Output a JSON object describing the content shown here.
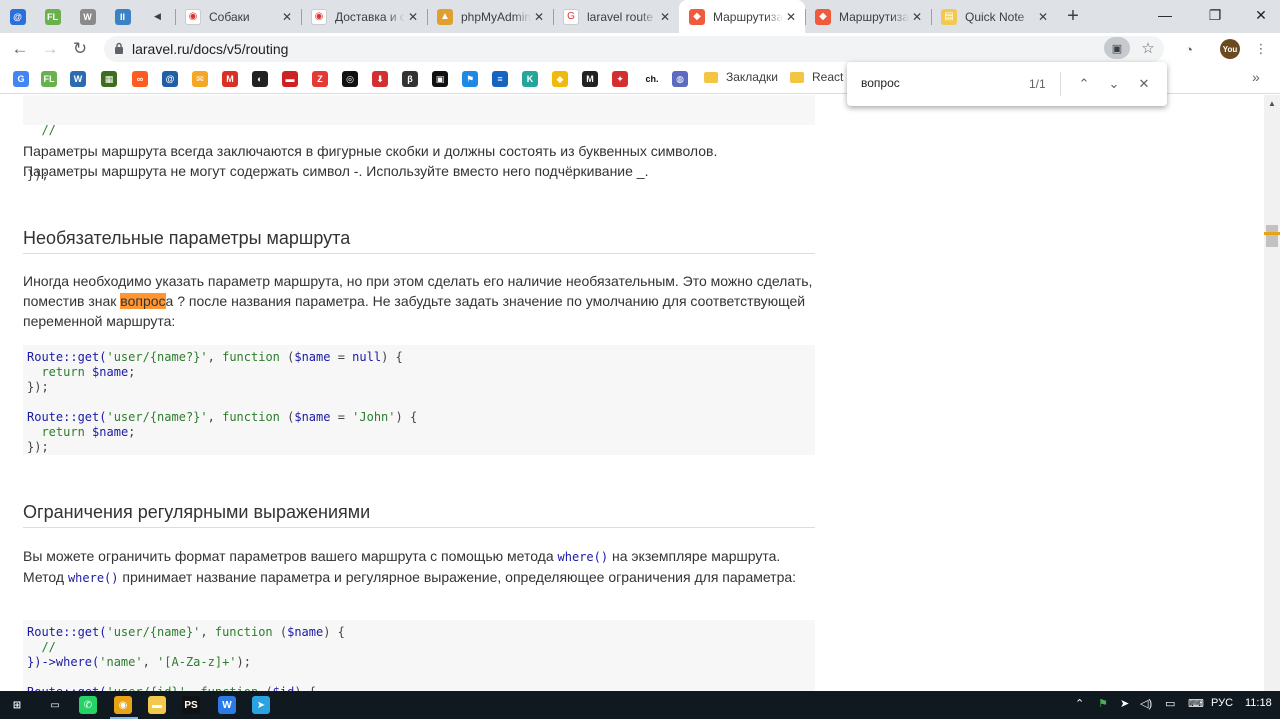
{
  "tabs": {
    "pinned": [
      {
        "name": "tab-pinned-1",
        "icon": "at-sign-icon",
        "glyph": "@",
        "color": "#2a6fdb"
      },
      {
        "name": "tab-pinned-2",
        "icon": "fl-icon",
        "glyph": "FL",
        "color": "#6ab04c"
      },
      {
        "name": "tab-pinned-3",
        "icon": "w-icon",
        "glyph": "W",
        "color": "#8a8a8a"
      },
      {
        "name": "tab-pinned-4",
        "icon": "pause-icon",
        "glyph": "II",
        "color": "#3b82c4"
      },
      {
        "name": "tab-pinned-5",
        "icon": "speaker-icon",
        "glyph": "◀",
        "color": "#dee1e6"
      }
    ],
    "items": [
      {
        "title": "Собаки",
        "icon": "eye-icon",
        "glyph": "◉",
        "color": "#ffffff",
        "active": false
      },
      {
        "title": "Доставка и о",
        "icon": "eye-icon",
        "glyph": "◉",
        "color": "#ffffff",
        "active": false
      },
      {
        "title": "phpMyAdmin",
        "icon": "sailboat-icon",
        "glyph": "▲",
        "color": "#e0a030",
        "active": false
      },
      {
        "title": "laravel route",
        "icon": "google-icon",
        "glyph": "G",
        "color": "#ffffff",
        "active": false
      },
      {
        "title": "Маршрутиза",
        "icon": "laravel-icon",
        "glyph": "◆",
        "color": "#ef5b3c",
        "active": true
      },
      {
        "title": "Маршрутиза",
        "icon": "laravel-icon",
        "glyph": "◆",
        "color": "#ef5b3c",
        "active": false
      },
      {
        "title": "Quick Note",
        "icon": "note-icon",
        "glyph": "▤",
        "color": "#f2c94c",
        "active": false
      }
    ],
    "new_tab": "+",
    "close": "✕"
  },
  "window_controls": {
    "minimize": "—",
    "maximize": "❐",
    "close": "✕"
  },
  "toolbar": {
    "back": "←",
    "forward": "→",
    "reload": "↻",
    "url": "laravel.ru/docs/v5/routing",
    "lock": "🔒",
    "star": "☆",
    "avatar": "You"
  },
  "bookmarks": {
    "icons": [
      {
        "name": "bookmark-google",
        "glyph": "G",
        "color": "#4285f4"
      },
      {
        "name": "bookmark-fl",
        "glyph": "FL",
        "color": "#6ab04c"
      },
      {
        "name": "bookmark-w",
        "glyph": "W",
        "color": "#2b6cb0"
      },
      {
        "name": "bookmark-book",
        "glyph": "▦",
        "color": "#3c6e1e"
      },
      {
        "name": "bookmark-chain",
        "glyph": "∞",
        "color": "#ff5a1f"
      },
      {
        "name": "bookmark-at",
        "glyph": "@",
        "color": "#1e5fa8"
      },
      {
        "name": "bookmark-mail",
        "glyph": "✉",
        "color": "#f5a623"
      },
      {
        "name": "bookmark-gmail",
        "glyph": "M",
        "color": "#d93025"
      },
      {
        "name": "bookmark-circle",
        "glyph": "◐",
        "color": "#222222"
      },
      {
        "name": "bookmark-box",
        "glyph": "▬",
        "color": "#cc2222"
      },
      {
        "name": "bookmark-z",
        "glyph": "Z",
        "color": "#e53935"
      },
      {
        "name": "bookmark-github",
        "glyph": "◎",
        "color": "#111111"
      },
      {
        "name": "bookmark-download",
        "glyph": "⬇",
        "color": "#d32f2f"
      },
      {
        "name": "bookmark-beta",
        "glyph": "β",
        "color": "#333333"
      },
      {
        "name": "bookmark-film",
        "glyph": "▣",
        "color": "#111111"
      },
      {
        "name": "bookmark-flag",
        "glyph": "⚑",
        "color": "#1e88e5"
      },
      {
        "name": "bookmark-stack",
        "glyph": "≡",
        "color": "#1565c0"
      },
      {
        "name": "bookmark-k",
        "glyph": "K",
        "color": "#26a69a"
      },
      {
        "name": "bookmark-binance",
        "glyph": "◆",
        "color": "#f0b90b"
      },
      {
        "name": "bookmark-m",
        "glyph": "M",
        "color": "#222222"
      },
      {
        "name": "bookmark-pepper",
        "glyph": "✦",
        "color": "#d32f2f"
      },
      {
        "name": "bookmark-ch",
        "glyph": "ch.",
        "color": "#ffffff"
      },
      {
        "name": "bookmark-globe",
        "glyph": "◍",
        "color": "#5c6bc0"
      }
    ],
    "folders": [
      "Закладки",
      "React"
    ],
    "more": "»"
  },
  "find": {
    "query": "вопрос",
    "count": "1/1",
    "up": "⌃",
    "down": "⌄",
    "close": "✕"
  },
  "article": {
    "code0": [
      "  //",
      "});"
    ],
    "p1": [
      "Параметры маршрута всегда заключаются в фигурные скобки и должны состоять из буквенных символов.",
      "Параметры маршрута не могут содержать символ -. Используйте вместо него подчёркивание _."
    ],
    "h_optional": "Необязательные параметры маршрута",
    "p2": {
      "before": "Иногда необходимо указать параметр маршрута, но при этом сделать его наличие необязательным. Это можно сделать, поместив знак ",
      "match": "вопрос",
      "after": "а ? после названия параметра. Не забудьте задать значение по умолчанию для соответствующей переменной маршрута:"
    },
    "code1": [
      {
        "parts": [
          [
            "Route::get(",
            "kw"
          ],
          [
            "'user/{name?}'",
            "st"
          ],
          [
            ", ",
            ""
          ],
          [
            "function",
            "st"
          ],
          [
            " (",
            ""
          ],
          [
            "$name",
            "vr"
          ],
          [
            " = ",
            ""
          ],
          [
            "null",
            "kw"
          ],
          [
            ") {",
            ""
          ]
        ]
      },
      {
        "parts": [
          [
            "  ",
            ""
          ],
          [
            "return",
            "st"
          ],
          [
            " ",
            ""
          ],
          [
            "$name",
            "vr"
          ],
          [
            ";",
            ""
          ]
        ]
      },
      {
        "parts": [
          [
            "});",
            ""
          ]
        ]
      },
      {
        "parts": [
          [
            "",
            ""
          ]
        ]
      },
      {
        "parts": [
          [
            "Route::get(",
            "kw"
          ],
          [
            "'user/{name?}'",
            "st"
          ],
          [
            ", ",
            ""
          ],
          [
            "function",
            "st"
          ],
          [
            " (",
            ""
          ],
          [
            "$name",
            "vr"
          ],
          [
            " = ",
            ""
          ],
          [
            "'John'",
            "st"
          ],
          [
            ") {",
            ""
          ]
        ]
      },
      {
        "parts": [
          [
            "  ",
            ""
          ],
          [
            "return",
            "st"
          ],
          [
            " ",
            ""
          ],
          [
            "$name",
            "vr"
          ],
          [
            ";",
            ""
          ]
        ]
      },
      {
        "parts": [
          [
            "});",
            ""
          ]
        ]
      }
    ],
    "h_regex": "Ограничения регулярными выражениями",
    "p3": {
      "t1": "Вы можете ограничить формат параметров вашего маршрута с помощью метода ",
      "c1": "where()",
      "t2": " на экземпляре маршрута. Метод ",
      "c2": "where()",
      "t3": " принимает название параметра и регулярное выражение, определяющее ограничения для параметра:"
    },
    "code2": [
      {
        "parts": [
          [
            "Route::get(",
            "kw"
          ],
          [
            "'user/{name}'",
            "st"
          ],
          [
            ", ",
            ""
          ],
          [
            "function",
            "st"
          ],
          [
            " (",
            ""
          ],
          [
            "$name",
            "vr"
          ],
          [
            ") {",
            ""
          ]
        ]
      },
      {
        "parts": [
          [
            "  //",
            "cm"
          ]
        ]
      },
      {
        "parts": [
          [
            "})->where(",
            "kw"
          ],
          [
            "'name'",
            "st"
          ],
          [
            ", ",
            ""
          ],
          [
            "'[A-Za-z]+'",
            "st"
          ],
          [
            ");",
            ""
          ]
        ]
      },
      {
        "parts": [
          [
            "",
            ""
          ]
        ]
      },
      {
        "parts": [
          [
            "Route::get(",
            "kw"
          ],
          [
            "'user/{id}'",
            "st"
          ],
          [
            ", ",
            ""
          ],
          [
            "function",
            "st"
          ],
          [
            " (",
            ""
          ],
          [
            "$id",
            "vr"
          ],
          [
            ") {",
            ""
          ]
        ]
      }
    ]
  },
  "taskbar": {
    "apps": [
      {
        "name": "start-button",
        "glyph": "⊞",
        "color": "#101820"
      },
      {
        "name": "task-view-button",
        "glyph": "▭",
        "color": "#101820"
      },
      {
        "name": "whatsapp-app",
        "glyph": "✆",
        "color": "#25d366"
      },
      {
        "name": "chrome-app",
        "glyph": "◉",
        "color": "#e8a317"
      },
      {
        "name": "explorer-app",
        "glyph": "▬",
        "color": "#f2c94c"
      },
      {
        "name": "phpstorm-app",
        "glyph": "PS",
        "color": "#111111"
      },
      {
        "name": "wamp-app",
        "glyph": "W",
        "color": "#2c7be5"
      },
      {
        "name": "telegram-app",
        "glyph": "➤",
        "color": "#2aa3e0"
      }
    ],
    "tray": {
      "lang": "РУС",
      "time": "11:18"
    }
  }
}
